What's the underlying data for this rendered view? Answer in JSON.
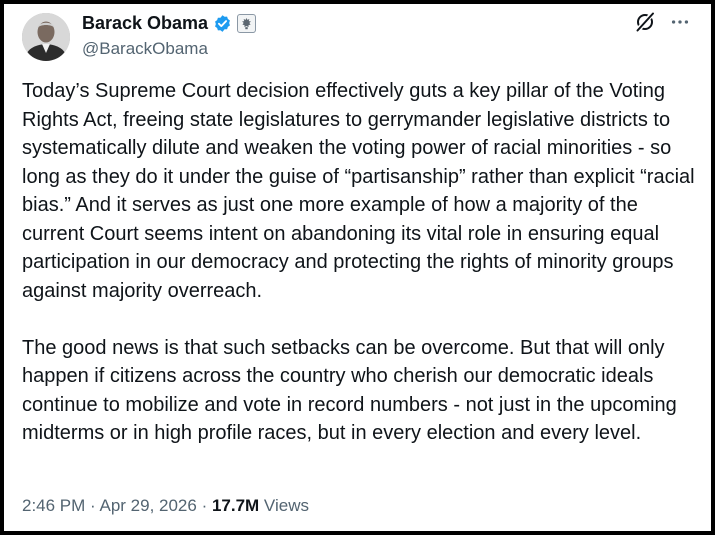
{
  "tweet": {
    "author": {
      "display_name": "Barack Obama",
      "handle": "@BarackObama",
      "verified_icon": "verified-badge-icon",
      "affiliation_icon": "government-seal-icon",
      "avatar_icon": "profile-photo-avatar"
    },
    "header_icons": {
      "grok": "grok-icon",
      "more": "more-options-icon"
    },
    "paragraphs": [
      "Today’s Supreme Court decision effectively guts a key pillar of the Voting Rights Act, freeing state legislatures to gerrymander legislative districts to systematically dilute and weaken the voting power of racial minorities - so long as they do it under the guise of “partisanship” rather than explicit “racial bias.” And it serves as just one more example of how a majority of the current Court seems intent on abandoning its vital role in ensuring equal participation in our democracy and protecting the rights of minority groups against majority overreach.",
      "The good news is that such setbacks can be overcome. But that will only happen if citizens across the country who cherish our democratic ideals continue to mobilize and vote in record numbers - not just in the upcoming midterms or in high profile races, but in every election and every level."
    ],
    "meta": {
      "time": "2:46 PM",
      "separator": " · ",
      "date": "Apr 29, 2026",
      "views_count": "17.7M",
      "views_label": " Views"
    },
    "colors": {
      "verified_blue": "#1d9bf0",
      "text_primary": "#0f1419",
      "text_secondary": "#536471"
    }
  }
}
